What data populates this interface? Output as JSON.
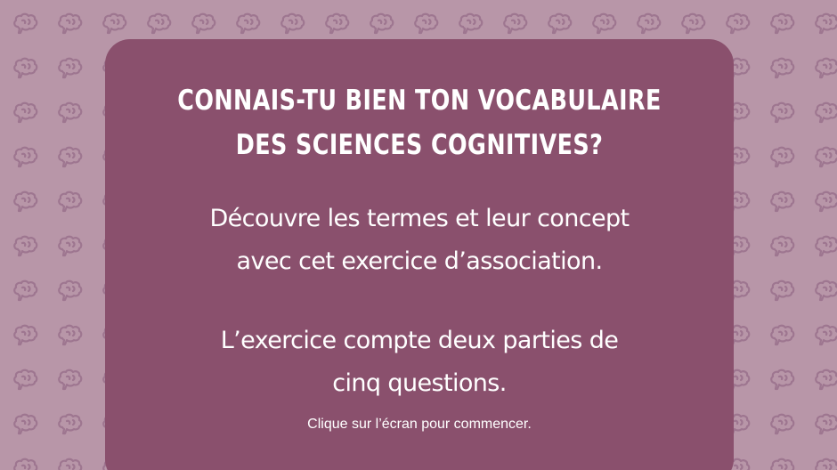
{
  "colors": {
    "background": "#b896a8",
    "pattern_icon": "#9e7690",
    "card": "#8a506d",
    "text": "#ffffff"
  },
  "background_icon": "brain-icon",
  "intro": {
    "title_lines": [
      "CONNAIS-TU BIEN TON VOCABULAIRE",
      "DES SCIENCES COGNITIVES?"
    ],
    "description_1_lines": [
      "Découvre les termes et leur concept",
      "avec cet exercice d’association."
    ],
    "description_2_lines": [
      "L’exercice compte deux parties de",
      "cinq questions."
    ],
    "hint": "Clique sur l’écran pour commencer."
  }
}
